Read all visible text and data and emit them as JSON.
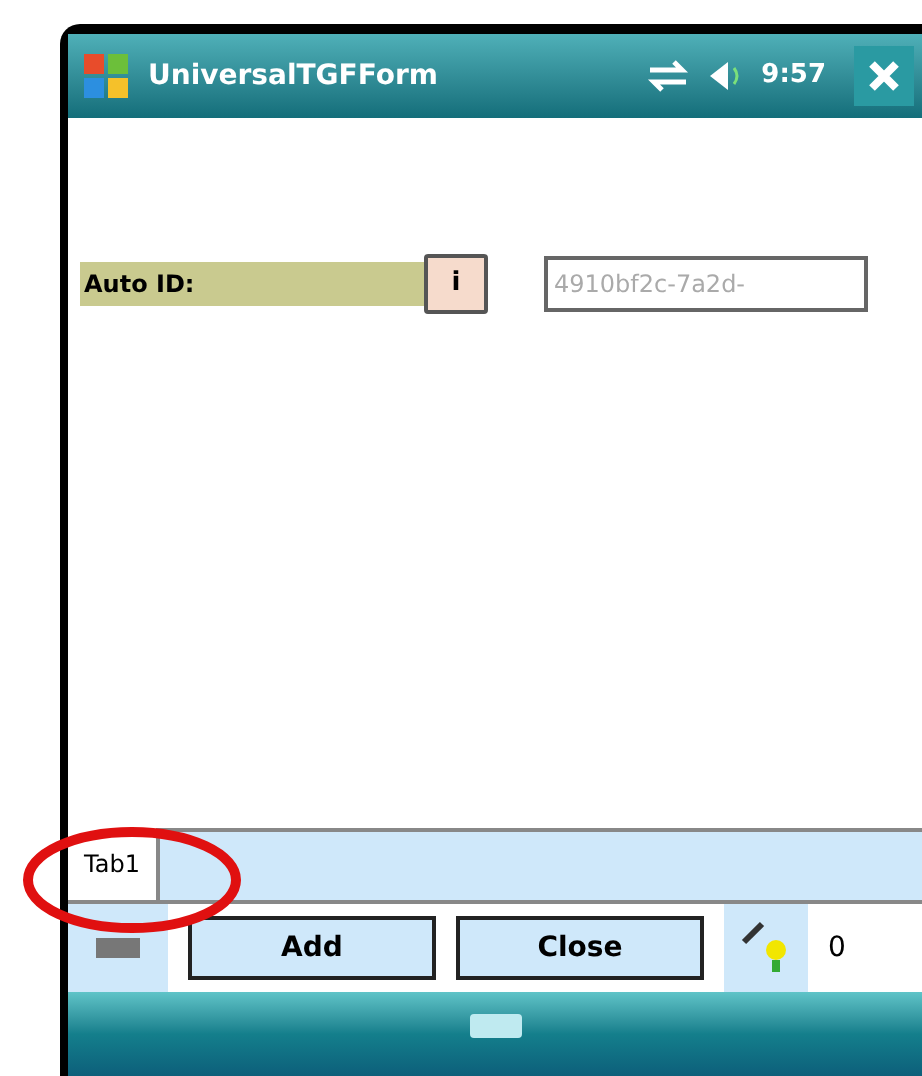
{
  "window": {
    "title": "UniversalTGFForm",
    "time": "9:57"
  },
  "fields": [
    {
      "label": "Auto ID:",
      "button": "i",
      "value": "4910bf2c-7a2d-"
    }
  ],
  "tabs": [
    {
      "label": "Tab1",
      "selected": true
    }
  ],
  "toolbar": {
    "buttons": [
      "Add",
      "Close"
    ],
    "trailing_text": "0"
  }
}
